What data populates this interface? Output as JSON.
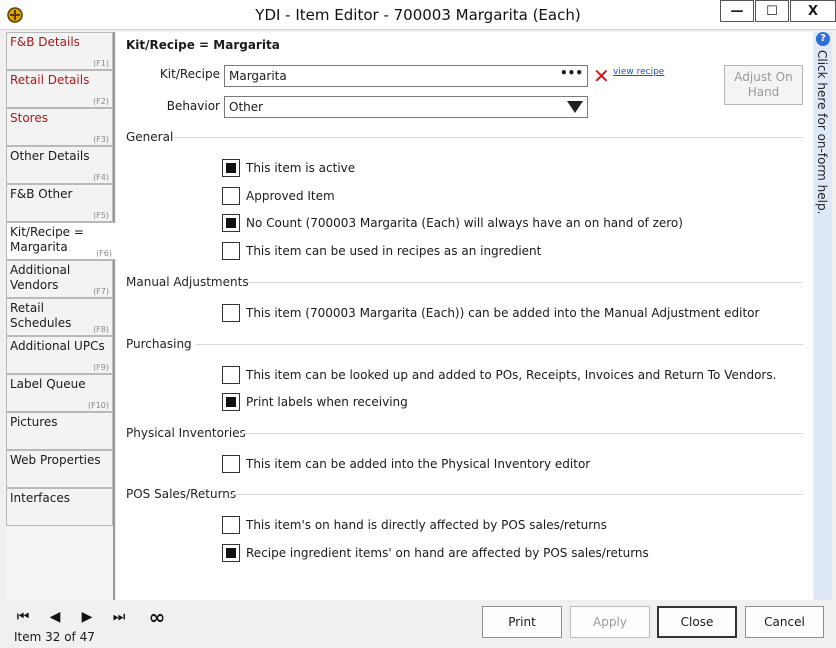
{
  "window": {
    "title": "YDI - Item Editor - 700003 Margarita (Each)",
    "minimize": "—",
    "maximize": "☐",
    "close": "X"
  },
  "nav": [
    {
      "label": "F&B Details",
      "key": "(F1)"
    },
    {
      "label": "Retail Details",
      "key": "(F2)"
    },
    {
      "label": "Stores",
      "key": "(F3)"
    },
    {
      "label": "Other Details",
      "key": "(F4)"
    },
    {
      "label": "F&B Other",
      "key": "(F5)"
    },
    {
      "label": "Kit/Recipe = Margarita",
      "key": "(F6)"
    },
    {
      "label": "Additional Vendors",
      "key": "(F7)"
    },
    {
      "label": "Retail Schedules",
      "key": "(F8)"
    },
    {
      "label": "Additional UPCs",
      "key": "(F9)"
    },
    {
      "label": "Label Queue",
      "key": "(F10)"
    },
    {
      "label": "Pictures",
      "key": ""
    },
    {
      "label": "Web Properties",
      "key": ""
    },
    {
      "label": "Interfaces",
      "key": ""
    }
  ],
  "main": {
    "heading": "Kit/Recipe = Margarita",
    "kit_label": "Kit/Recipe",
    "kit_value": "Margarita",
    "kit_dots": "•••",
    "clear_icon": "✕",
    "view_recipe": "view recipe",
    "behavior_label": "Behavior",
    "behavior_value": "Other",
    "adjust_button": "Adjust On Hand"
  },
  "sections": {
    "general": "General",
    "manual": "Manual Adjustments",
    "purchasing": "Purchasing",
    "physical": "Physical Inventories",
    "pos": "POS Sales/Returns"
  },
  "checkboxes": {
    "active": {
      "label": "This item is active",
      "checked": true
    },
    "approved": {
      "label": "Approved Item",
      "checked": false
    },
    "no_count": {
      "label": "No Count (700003 Margarita (Each) will always have an on hand of zero)",
      "checked": true
    },
    "recipe_ingredient": {
      "label": "This item can be used in recipes as an ingredient",
      "checked": false
    },
    "manual_adjust": {
      "label": "This item (700003 Margarita (Each)) can be added into the Manual Adjustment editor",
      "checked": false
    },
    "purchasing_lookup": {
      "label": "This item can be looked up and added to POs, Receipts, Invoices and Return To Vendors.",
      "checked": false
    },
    "print_labels": {
      "label": "Print labels when receiving",
      "checked": true
    },
    "physical_inv": {
      "label": "This item can be added into the Physical Inventory editor",
      "checked": false
    },
    "pos_direct": {
      "label": "This item's on hand is directly affected by POS sales/returns",
      "checked": false
    },
    "pos_recipe": {
      "label": "Recipe ingredient items' on hand are affected by POS sales/returns",
      "checked": true
    }
  },
  "help": {
    "icon": "?",
    "text": "Click here for on-form help."
  },
  "footer": {
    "first": "⏮",
    "prev": "◀",
    "next": "▶",
    "last": "⏭",
    "loop": "∞",
    "item_count": "Item 32 of 47",
    "print": "Print",
    "apply": "Apply",
    "close": "Close",
    "cancel": "Cancel"
  }
}
